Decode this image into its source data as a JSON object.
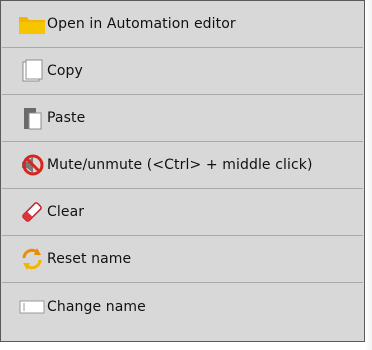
{
  "menu": {
    "items": [
      {
        "label": "Open in Automation editor",
        "icon": "folder-icon"
      },
      {
        "label": "Copy",
        "icon": "copy-icon"
      },
      {
        "label": "Paste",
        "icon": "paste-icon"
      },
      {
        "label": "Mute/unmute (<Ctrl> + middle click)",
        "icon": "mute-icon"
      },
      {
        "label": "Clear",
        "icon": "eraser-icon"
      },
      {
        "label": "Reset name",
        "icon": "reset-icon"
      },
      {
        "label": "Change name",
        "icon": "rename-icon"
      }
    ]
  },
  "colors": {
    "menu_background": "#d8d8d8",
    "separator": "#a9a9a9",
    "border": "#5a5a5a",
    "folder": "#f2b600",
    "mute_red": "#d7261e",
    "reset_orange": "#f08a00"
  }
}
